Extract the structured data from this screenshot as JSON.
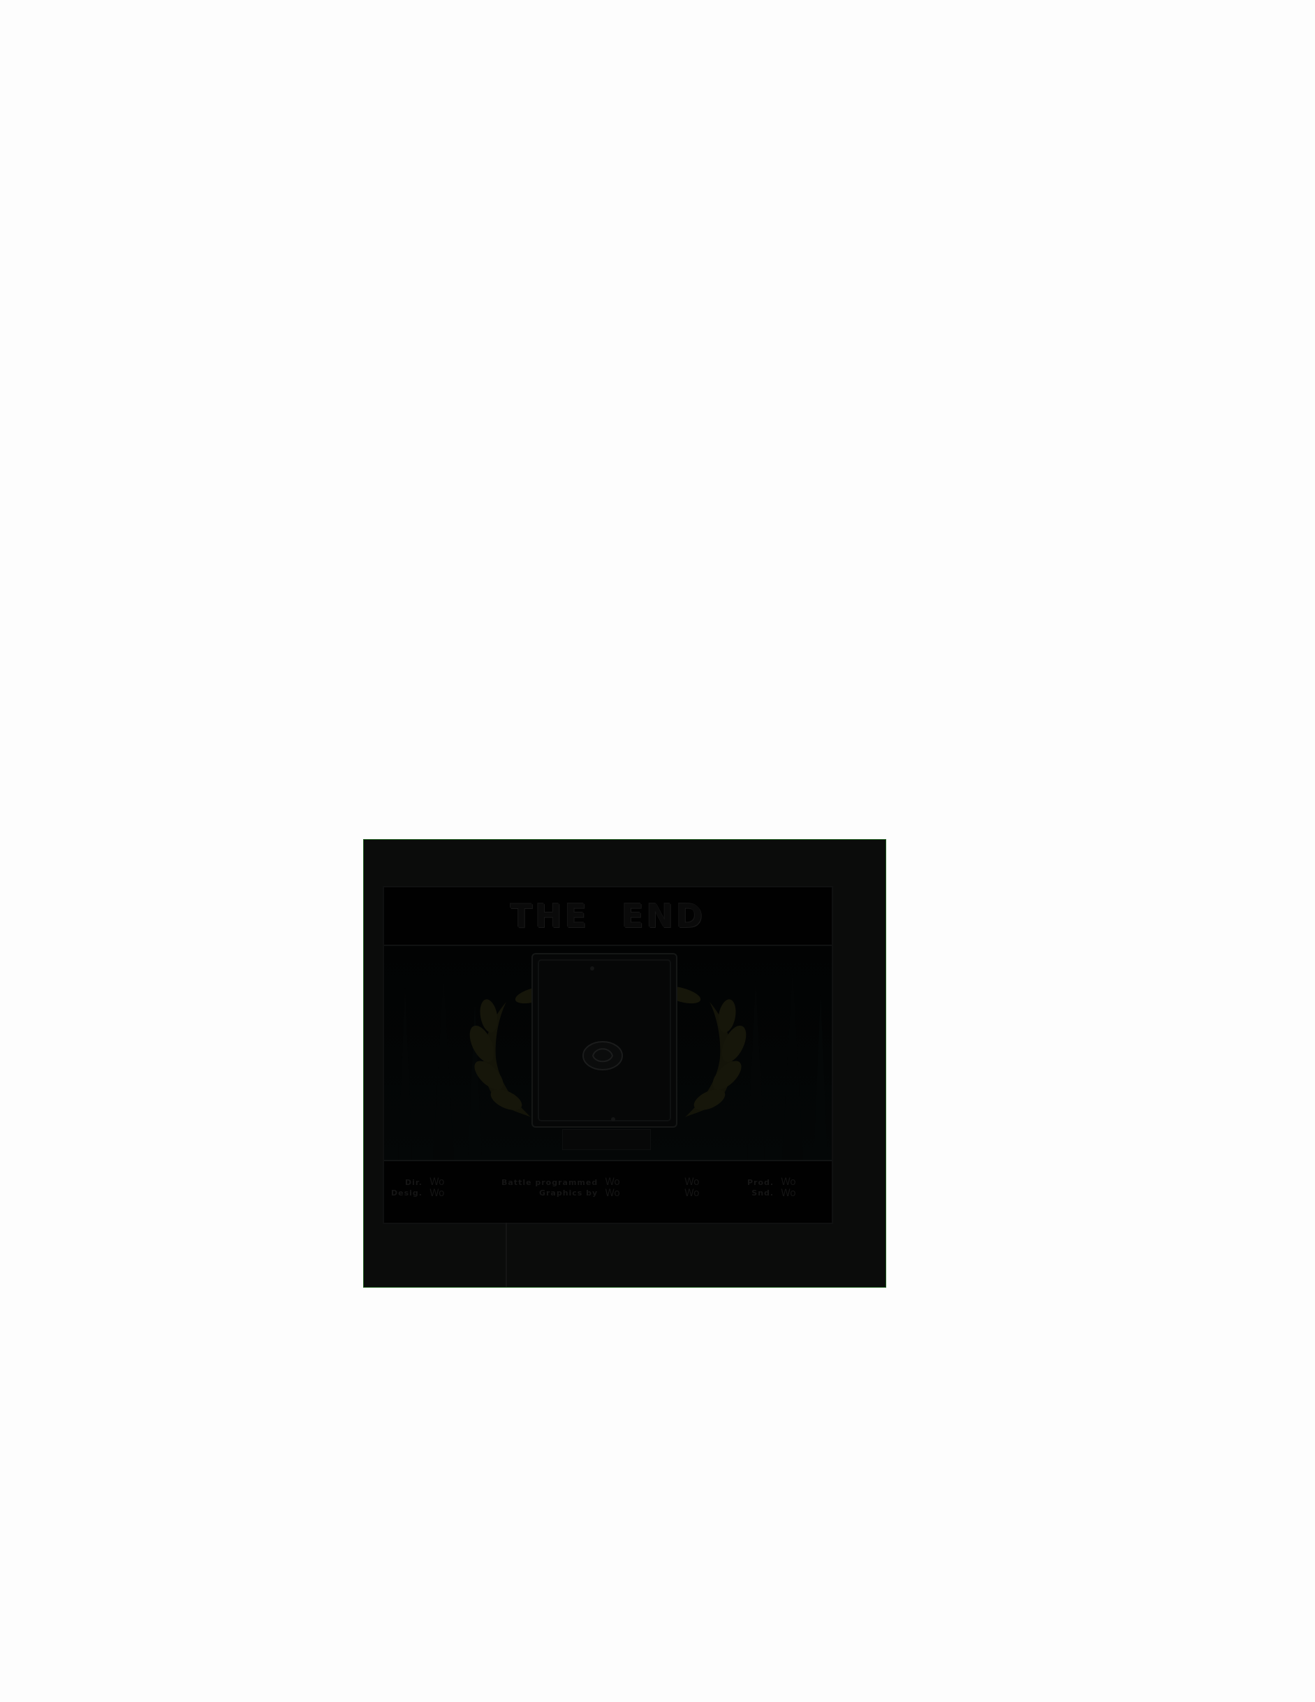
{
  "screen": {
    "title": "THE END",
    "credits": [
      {
        "role": [
          "Dir.",
          "Desig."
        ],
        "name": [
          "Wo",
          "Wo"
        ]
      },
      {
        "role": [
          "Battle programmed",
          "Graphics by"
        ],
        "name": [
          "Wo",
          "Wo"
        ]
      },
      {
        "role": [
          "",
          ""
        ],
        "name": [
          "Wo",
          "Wo"
        ]
      },
      {
        "role": [
          "Prod.",
          "Snd."
        ],
        "name": [
          "Wo",
          "Wo"
        ]
      }
    ]
  },
  "colors": {
    "frame_border": "#1f5d1f",
    "laurel": "#1a1a06",
    "background": "#0b0c0b"
  },
  "icons": [
    "laurel-wreath-left-icon",
    "laurel-wreath-right-icon",
    "trophy-emblem-icon"
  ]
}
